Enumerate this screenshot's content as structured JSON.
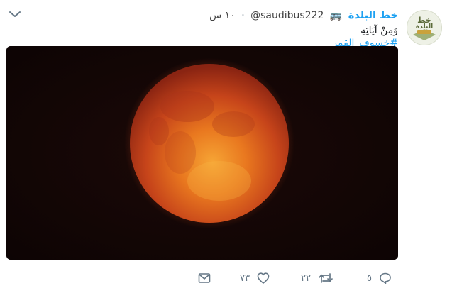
{
  "tweet": {
    "author_name": "خط البلدة",
    "author_badge_icon": "bus-emoji",
    "author_badge_glyph": "🚌",
    "handle": "@saudibus222",
    "separator": "·",
    "time": "١٠ س",
    "text_line1": "وَمِنْ آيَاتِهِ",
    "hashtag": "#خسوف_القمر",
    "avatar_text_top": "خط",
    "avatar_text_bottom": "البلدة"
  },
  "actions": {
    "reply_count": "٥",
    "retweet_count": "٢٢",
    "like_count": "٧٣"
  },
  "colors": {
    "link": "#1da1f2",
    "muted": "#657786",
    "media_bg": "#120607"
  }
}
